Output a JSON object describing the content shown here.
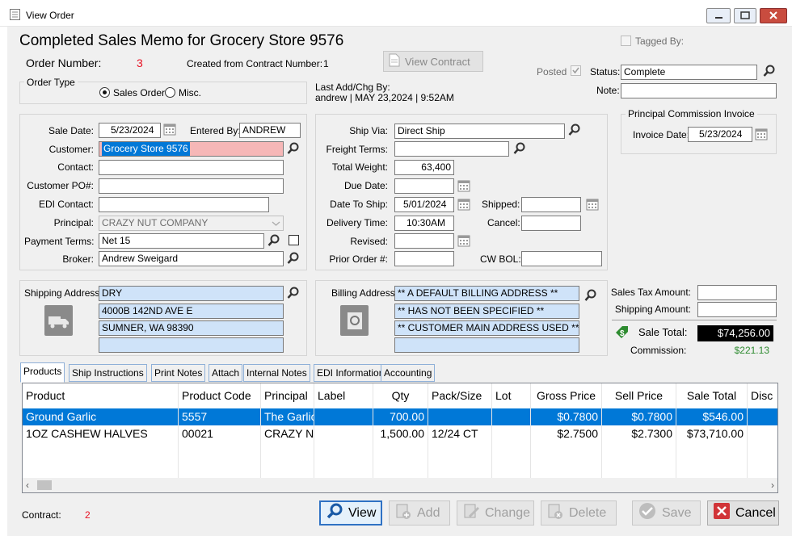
{
  "window": {
    "title": "View Order"
  },
  "header": {
    "heading": "Completed Sales Memo for Grocery Store 9576",
    "order_number_label": "Order Number:",
    "order_number": "3",
    "created_from_label": "Created from Contract Number:",
    "contract_number": "1",
    "view_contract_label": "View Contract",
    "tagged_by_label": "Tagged By:",
    "posted_label": "Posted",
    "posted_checked": true,
    "status_label": "Status:",
    "status_value": "Complete",
    "note_label": "Note:",
    "note_value": "",
    "last_chg_label": "Last Add/Chg By:",
    "last_chg_value": "andrew | MAY 23,2024 |  9:52AM"
  },
  "order_type": {
    "title": "Order Type",
    "options": [
      "Sales Order",
      "Misc."
    ],
    "selected": "Sales Order"
  },
  "commission_invoice": {
    "title": "Principal Commission Invoice",
    "date_label": "Invoice Date:",
    "date_value": "5/23/2024"
  },
  "left_form": {
    "sale_date_label": "Sale Date:",
    "sale_date": "5/23/2024",
    "entered_by_label": "Entered By:",
    "entered_by": "ANDREW",
    "customer_label": "Customer:",
    "customer": "Grocery Store 9576",
    "contact_label": "Contact:",
    "contact": "",
    "customer_po_label": "Customer PO#:",
    "customer_po": "",
    "edi_contact_label": "EDI Contact:",
    "edi_contact": "",
    "principal_label": "Principal:",
    "principal": "CRAZY NUT COMPANY",
    "payment_terms_label": "Payment Terms:",
    "payment_terms": "Net 15",
    "broker_label": "Broker:",
    "broker": "Andrew Sweigard"
  },
  "mid_form": {
    "ship_via_label": "Ship Via:",
    "ship_via": "Direct Ship",
    "freight_terms_label": "Freight Terms:",
    "freight_terms": "",
    "total_weight_label": "Total Weight:",
    "total_weight": "63,400",
    "due_date_label": "Due Date:",
    "due_date": "",
    "date_to_ship_label": "Date To Ship:",
    "date_to_ship": "5/01/2024",
    "shipped_label": "Shipped:",
    "shipped": "",
    "delivery_time_label": "Delivery Time:",
    "delivery_time": "10:30AM",
    "cancel_label": "Cancel:",
    "cancel": "",
    "revised_label": "Revised:",
    "revised": "",
    "prior_order_label": "Prior Order #:",
    "prior_order": "",
    "cw_bol_label": "CW BOL:",
    "cw_bol": ""
  },
  "shipping_address": {
    "label": "Shipping Address:",
    "lines": [
      "DRY",
      "4000B 142ND AVE E",
      "SUMNER, WA 98390",
      ""
    ]
  },
  "billing_address": {
    "label": "Billing Address:",
    "lines": [
      "** A DEFAULT BILLING ADDRESS **",
      "** HAS NOT BEEN SPECIFIED **",
      "** CUSTOMER MAIN ADDRESS USED **",
      ""
    ]
  },
  "totals": {
    "sales_tax_label": "Sales Tax Amount:",
    "sales_tax": "",
    "shipping_amount_label": "Shipping Amount:",
    "shipping_amount": "",
    "sale_total_label": "Sale Total:",
    "sale_total": "$74,256.00",
    "commission_label": "Commission:",
    "commission": "$221.13"
  },
  "tabs": [
    "Products",
    "Ship Instructions",
    "Print Notes",
    "Attach",
    "Internal Notes",
    "EDI Information",
    "Accounting"
  ],
  "grid": {
    "columns": [
      "Product",
      "Product Code",
      "Principal",
      "Label",
      "Qty",
      "Pack/Size",
      "Lot",
      "Gross Price",
      "Sell Price",
      "Sale Total",
      "Disc"
    ],
    "rows": [
      [
        "Ground Garlic",
        "5557",
        "The Garlic",
        "",
        "700.00",
        "",
        "",
        "$0.7800",
        "$0.7800",
        "$546.00",
        ""
      ],
      [
        "1OZ CASHEW HALVES",
        "00021",
        "CRAZY NU",
        "",
        "1,500.00",
        "12/24 CT",
        "",
        "$2.7500",
        "$2.7300",
        "$73,710.00",
        ""
      ]
    ]
  },
  "footer": {
    "contract_label": "Contract:",
    "contract_value": "2"
  },
  "buttons": {
    "view": "View",
    "add": "Add",
    "change": "Change",
    "delete": "Delete",
    "save": "Save",
    "cancel": "Cancel"
  },
  "colors": {
    "selection": "#0078d7",
    "red_value": "#e81123",
    "green_value": "#2e8b30",
    "sale_total_bg": "#000000"
  }
}
